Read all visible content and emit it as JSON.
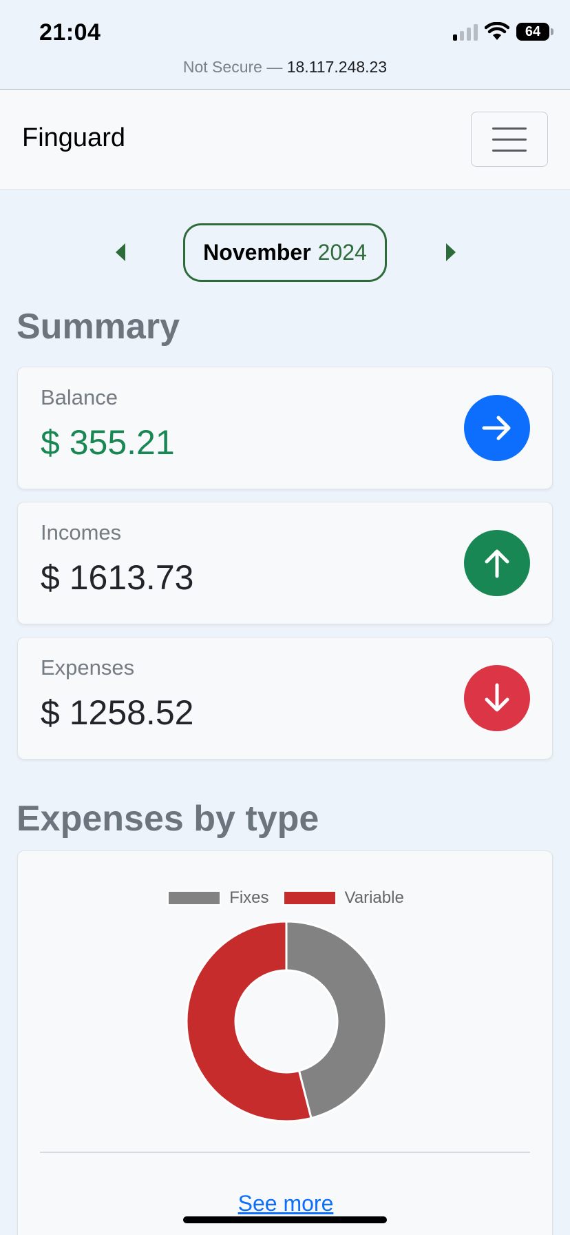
{
  "status_bar": {
    "time": "21:04",
    "battery": "64",
    "url_prefix": "Not Secure —",
    "url_host": "18.117.248.23"
  },
  "navbar": {
    "brand": "Finguard",
    "menu_icon": "hamburger-menu-icon"
  },
  "month_selector": {
    "month": "November",
    "year": "2024",
    "prev_icon": "caret-left-icon",
    "next_icon": "caret-right-icon",
    "accent_color": "#2e6b3a"
  },
  "summary": {
    "title": "Summary",
    "cards": [
      {
        "label": "Balance",
        "value": "$ 355.21",
        "icon": "arrow-right-icon",
        "color": "#0d6efd"
      },
      {
        "label": "Incomes",
        "value": "$ 1613.73",
        "icon": "arrow-up-icon",
        "color": "#198754"
      },
      {
        "label": "Expenses",
        "value": "$ 1258.52",
        "icon": "arrow-down-icon",
        "color": "#dc3545"
      }
    ]
  },
  "expenses_by_type": {
    "title": "Expenses by type",
    "see_more": "See more"
  },
  "chart_data": {
    "type": "pie",
    "variant": "doughnut",
    "categories": [
      "Fixes",
      "Variable"
    ],
    "values": [
      46,
      54
    ],
    "colors": [
      "#828282",
      "#c62c2c"
    ],
    "legend": "top"
  }
}
